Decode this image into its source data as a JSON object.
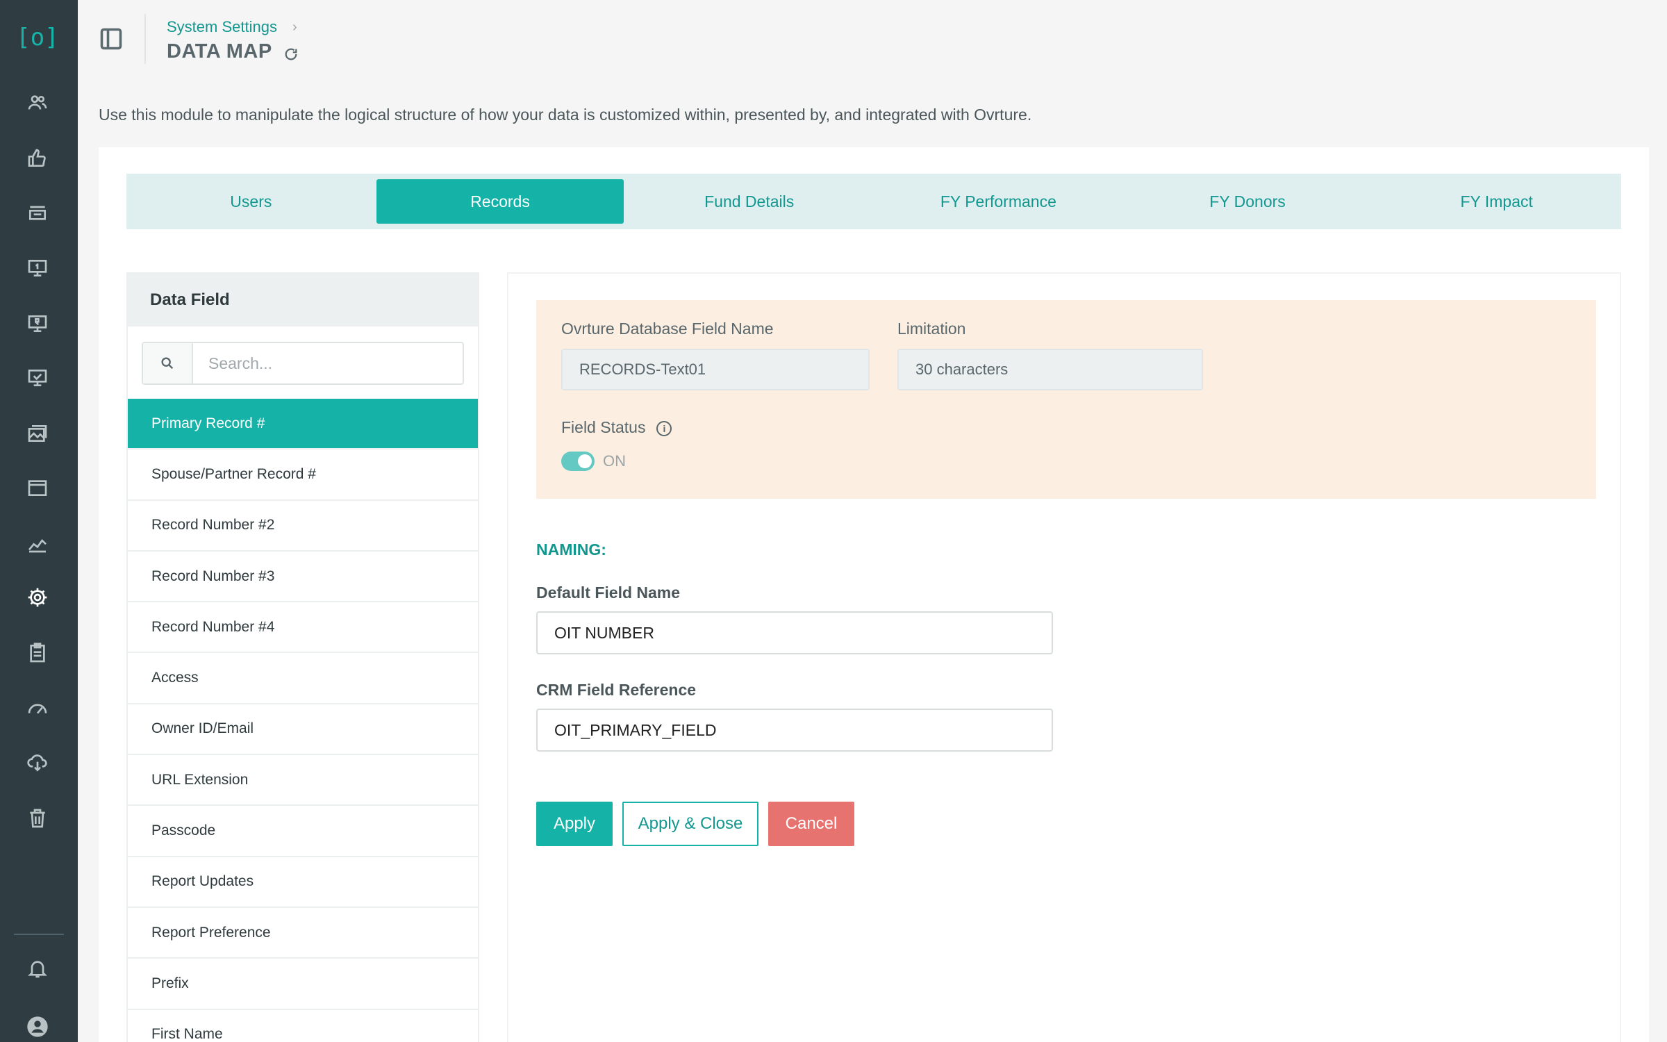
{
  "sidebar": {
    "logo_glyph": "[o]",
    "icons": [
      "users-icon",
      "thumbs-up-icon",
      "inbox-icon",
      "monitor-dollar-icon",
      "monitor-report-icon",
      "monitor-check-icon",
      "gallery-icon",
      "calendar-icon",
      "trend-chart-icon",
      "gear-icon",
      "clipboard-icon",
      "speedometer-icon",
      "cloud-download-icon",
      "trash-icon",
      "bell-icon",
      "account-icon"
    ],
    "active_icon": "gear-icon"
  },
  "header": {
    "breadcrumb": "System Settings",
    "title": "DATA MAP"
  },
  "intro": "Use this module to manipulate the logical structure of how your data is customized within, presented by, and integrated with Ovrture.",
  "tabs": [
    {
      "label": "Users",
      "active": false
    },
    {
      "label": "Records",
      "active": true
    },
    {
      "label": "Fund Details",
      "active": false
    },
    {
      "label": "FY Performance",
      "active": false
    },
    {
      "label": "FY Donors",
      "active": false
    },
    {
      "label": "FY Impact",
      "active": false
    }
  ],
  "data_field": {
    "title": "Data Field",
    "search_placeholder": "Search...",
    "items": [
      "Primary Record #",
      "Spouse/Partner Record #",
      "Record Number #2",
      "Record Number #3",
      "Record Number #4",
      "Access",
      "Owner ID/Email",
      "URL Extension",
      "Passcode",
      "Report Updates",
      "Report Preference",
      "Prefix",
      "First Name"
    ],
    "active_index": 0
  },
  "details": {
    "db_field_label": "Ovrture Database Field Name",
    "db_field_value": "RECORDS-Text01",
    "limitation_label": "Limitation",
    "limitation_value": "30 characters",
    "status_label": "Field Status",
    "status_value": "ON",
    "naming_title": "NAMING:",
    "default_name_label": "Default Field Name",
    "default_name_value": "OIT NUMBER",
    "crm_label": "CRM Field Reference",
    "crm_value": "OIT_PRIMARY_FIELD"
  },
  "buttons": {
    "apply": "Apply",
    "apply_close": "Apply & Close",
    "cancel": "Cancel"
  },
  "colors": {
    "accent": "#15b2a8",
    "sidebar_bg": "#2f3d42",
    "info_bg": "#fcefe1",
    "cancel": "#e67370"
  }
}
